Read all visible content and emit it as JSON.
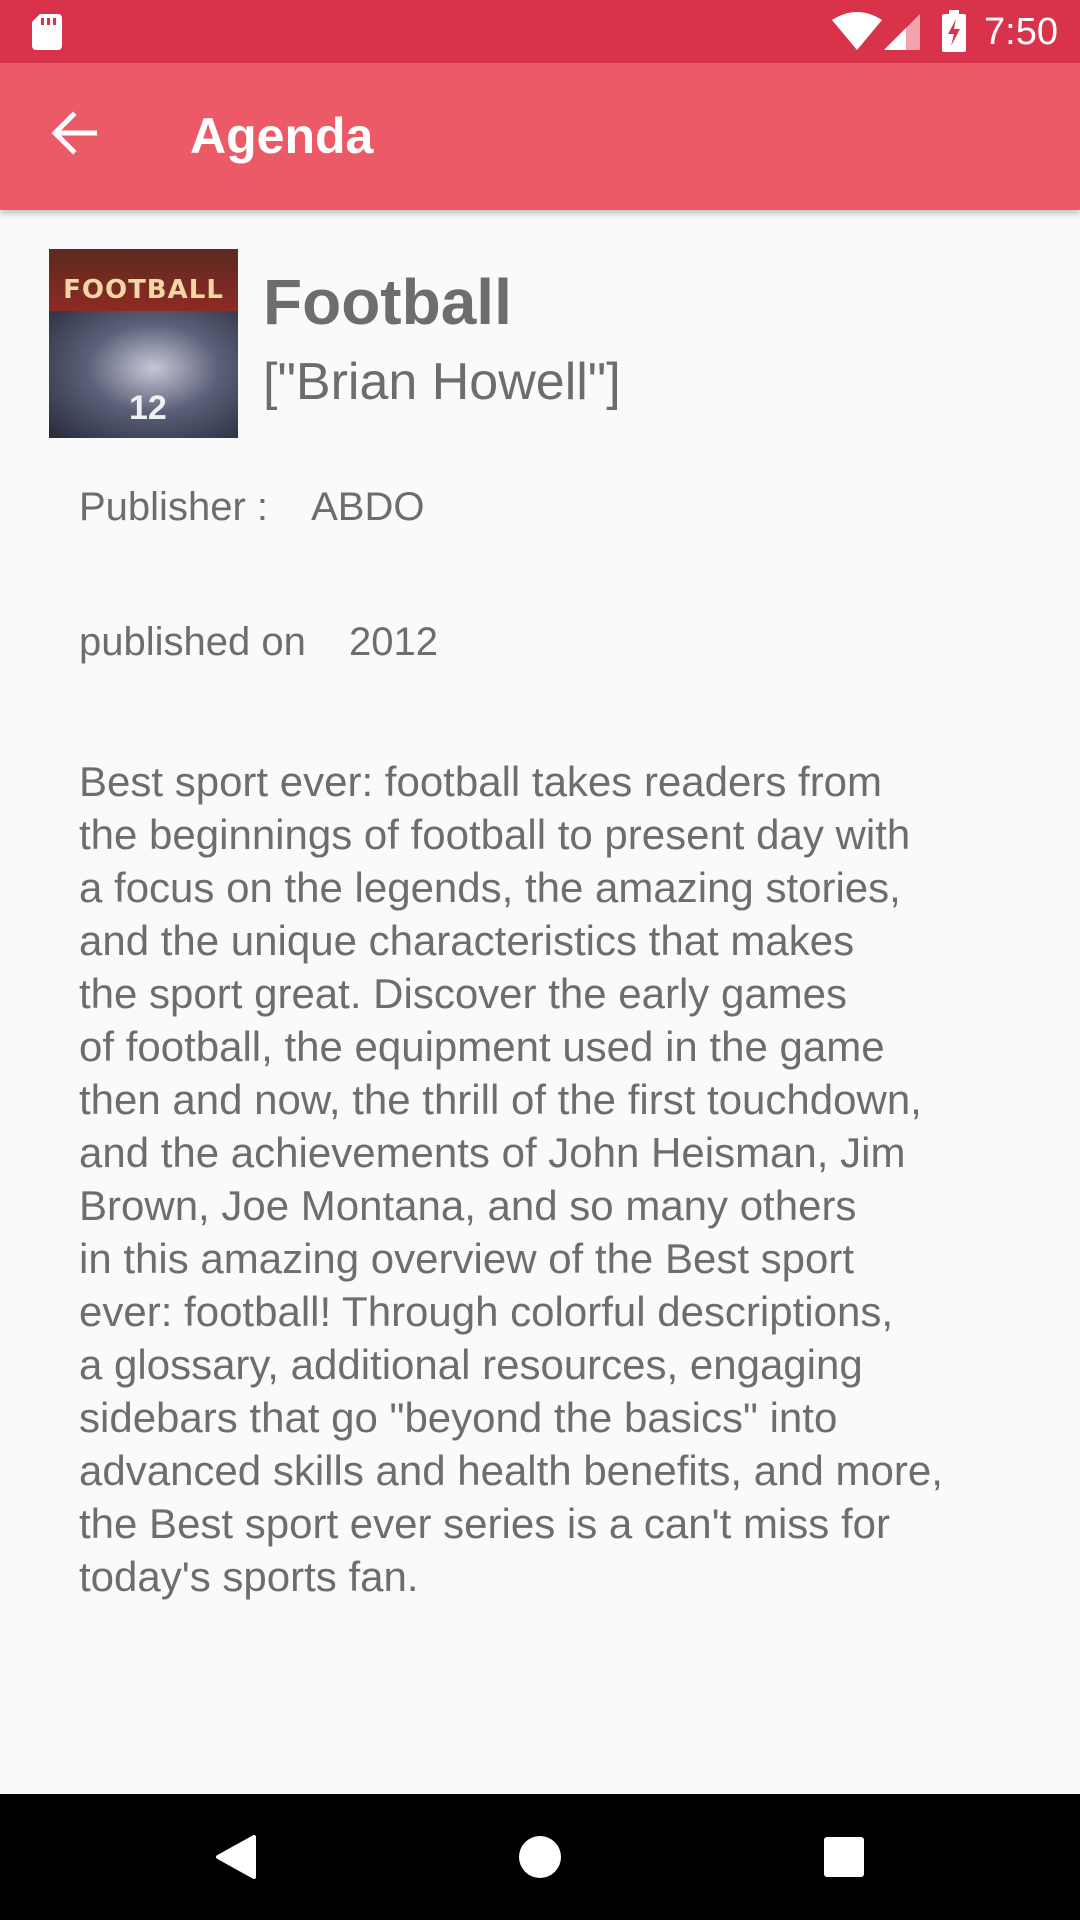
{
  "status_bar": {
    "time": "7:50",
    "icons": [
      "sd-card-icon",
      "wifi-icon",
      "signal-icon",
      "battery-charging-icon"
    ]
  },
  "app_bar": {
    "title": "Agenda",
    "back_icon": "arrow-back-icon"
  },
  "book": {
    "cover_label": "FOOTBALL",
    "cover_number": "12",
    "title": "Football",
    "author": "[\"Brian Howell\"]",
    "publisher_label": "Publisher :",
    "publisher": "ABDO",
    "published_label": "published on",
    "published_year": "2012",
    "description": "Best sport ever: football takes readers from\nthe beginnings of football to present day with\na focus on the legends, the amazing stories,\nand the unique characteristics that makes\nthe sport great. Discover the early games\nof football, the equipment used in the game\nthen and now, the thrill of the first touchdown,\nand the achievements of John Heisman, Jim\nBrown, Joe Montana, and so many others\nin this amazing overview of the Best sport\never: football! Through colorful descriptions,\na glossary, additional resources, engaging\nsidebars that go \"beyond the basics\" into\nadvanced skills and health benefits, and more,\nthe Best sport ever series is a can't miss for\ntoday's sports fan."
  },
  "nav_bar": {
    "icons": [
      "nav-back-icon",
      "nav-home-icon",
      "nav-recents-icon"
    ]
  },
  "colors": {
    "status_bar": "#d9334c",
    "app_bar": "#eb5a66",
    "text": "#6d6d6d",
    "background": "#fafafa"
  }
}
